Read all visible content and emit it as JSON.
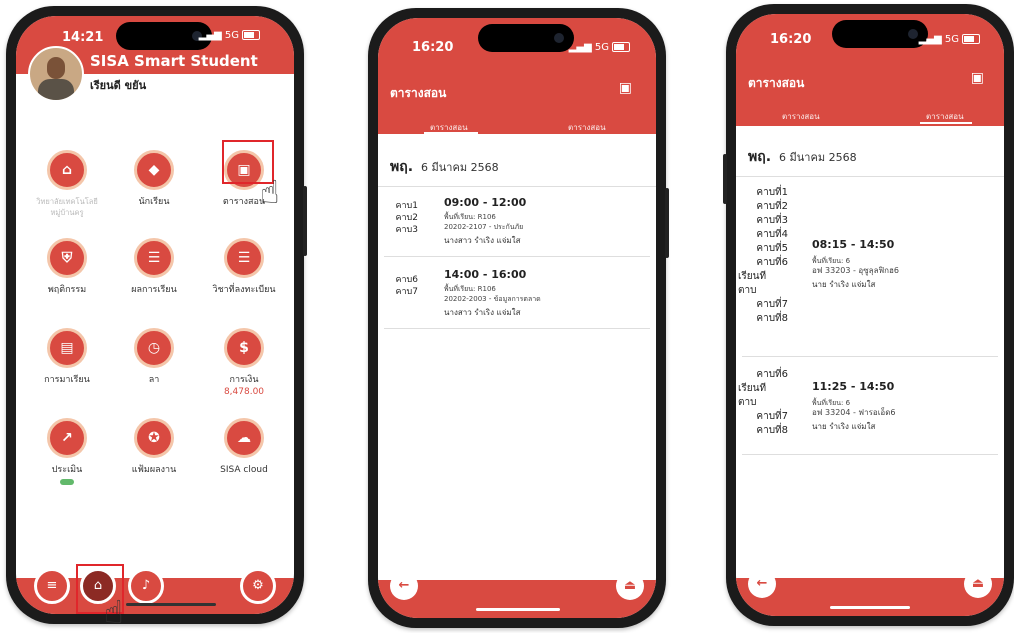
{
  "colors": {
    "accent": "#d94a41",
    "highlight": "#e0262b",
    "icon_ring": "#f4c6aa",
    "status_green": "#62b96b"
  },
  "phone1": {
    "status": {
      "time": "14:21",
      "network": "5G"
    },
    "app_title": "SISA Smart Student",
    "user_name": "เรียนดี ขยัน",
    "menu": [
      {
        "label": "วิทยาลัยเทคโนโลยีหมู่บ้านครู",
        "icon": "bank-icon",
        "faded": true
      },
      {
        "label": "นักเรียน",
        "icon": "graduation-cap-icon"
      },
      {
        "label": "ตารางสอน",
        "icon": "calendar-icon"
      },
      {
        "label": "พฤติกรรม",
        "icon": "shield-icon"
      },
      {
        "label": "ผลการเรียน",
        "icon": "grade-list-icon"
      },
      {
        "label": "วิชาที่ลงทะเบียน",
        "icon": "register-list-icon"
      },
      {
        "label": "การมาเรียน",
        "icon": "attendance-icon"
      },
      {
        "label": "ลา",
        "icon": "clock-icon"
      },
      {
        "label": "การเงิน",
        "sub": "8,478.00",
        "icon": "dollar-icon"
      },
      {
        "label": "ประเมิน",
        "icon": "chart-line-icon"
      },
      {
        "label": "แฟ้มผลงาน",
        "icon": "award-icon"
      },
      {
        "label": "SISA cloud",
        "icon": "cloud-icon"
      }
    ],
    "bottom_nav": [
      "menu-icon",
      "home-icon",
      "bell-icon",
      "gear-icon"
    ]
  },
  "phone2": {
    "status": {
      "time": "16:20",
      "network": "5G"
    },
    "title": "ตารางสอน",
    "tabs": [
      "ตารางสอน",
      "ตารางสอน"
    ],
    "date": {
      "dow": "พฤ.",
      "text": "6 มีนาคม 2568"
    },
    "slots": [
      {
        "periods": [
          "คาบ1",
          "คาบ2",
          "คาบ3"
        ],
        "time": "09:00 - 12:00",
        "room": "พื้นที่เรียน: R106",
        "subject": "20202-2107 - ประกันภัย",
        "teacher": "นางสาว  รำเริง  แจ่มใส"
      },
      {
        "periods": [
          "คาบ6",
          "คาบ7"
        ],
        "time": "14:00 - 16:00",
        "room": "พื้นที่เรียน: R106",
        "subject": "20202-2003 - ข้อมูลการตลาด",
        "teacher": "นางสาว  รำเริง  แจ่มใส"
      }
    ]
  },
  "phone3": {
    "status": {
      "time": "16:20",
      "network": "5G"
    },
    "title": "ตารางสอน",
    "tabs": [
      "ตารางสอน",
      "ตารางสอน"
    ],
    "date": {
      "dow": "พฤ.",
      "text": "6 มีนาคม 2568"
    },
    "slots": [
      {
        "periods": [
          "คาบที่1",
          "คาบที่2",
          "คาบที่3",
          "คาบที่4",
          "คาบที่5",
          "คาบที่6",
          "เรียนที",
          "ตาบ",
          "คาบที่7",
          "คาบที่8"
        ],
        "time": "08:15 - 14:50",
        "room": "พื้นที่เรียน: 6",
        "subject": "อฟ 33203 - อุซูลุลฟิกฮ6",
        "teacher": "นาย  รำเริง  แจ่มใส"
      },
      {
        "periods": [
          "คาบที่6",
          "เรียนที",
          "ตาบ",
          "คาบที่7",
          "คาบที่8"
        ],
        "time": "11:25 - 14:50",
        "room": "พื้นที่เรียน: 6",
        "subject": "อฟ 33204 - ฟารอเอ็ด6",
        "teacher": "นาย  รำเริง  แจ่มใส"
      }
    ]
  }
}
